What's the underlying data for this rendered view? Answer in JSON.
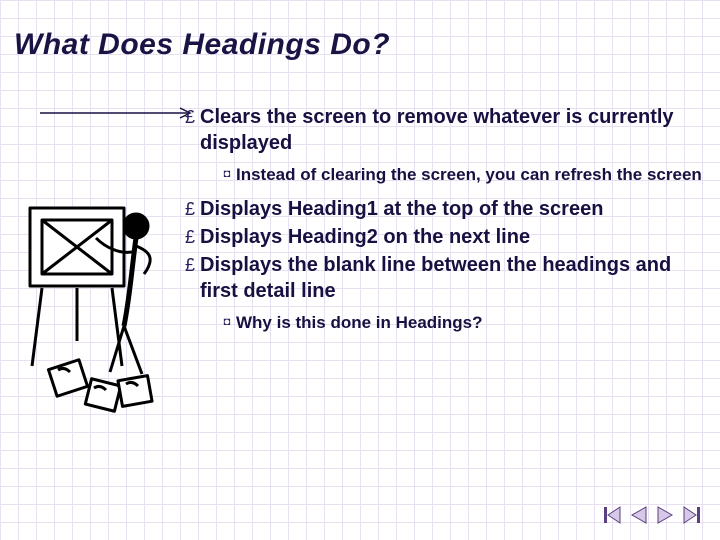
{
  "title": "What Does Headings Do?",
  "bullets": [
    {
      "text": "Clears the screen to remove whatever is currently displayed",
      "sub": "Instead of clearing the screen, you can refresh the screen"
    },
    {
      "text": "Displays Heading1 at the top of the screen"
    },
    {
      "text": "Displays Heading2 on the next line"
    },
    {
      "text": "Displays the blank line between the headings and first detail line",
      "sub": "Why is this done in Headings?"
    }
  ],
  "glyphs": {
    "main_bullet": "£",
    "sub_bullet": "◘"
  },
  "colors": {
    "title": "#1a1444",
    "text": "#181040",
    "accent": "#8a2a2a",
    "nav_fill": "#d8c8e8",
    "nav_stroke": "#5a4080"
  }
}
